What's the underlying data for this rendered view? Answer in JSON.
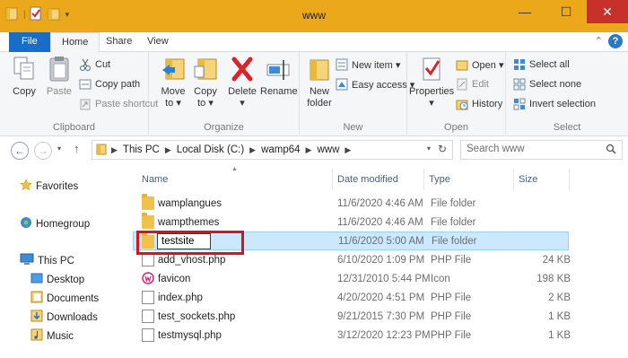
{
  "window": {
    "title": "www"
  },
  "tabs": {
    "file": "File",
    "home": "Home",
    "share": "Share",
    "view": "View"
  },
  "ribbon": {
    "clipboard": {
      "label": "Clipboard",
      "copy": "Copy",
      "paste": "Paste",
      "cut": "Cut",
      "copy_path": "Copy path",
      "paste_shortcut": "Paste shortcut"
    },
    "organize": {
      "label": "Organize",
      "move_to_1": "Move",
      "move_to_2": "to ▾",
      "copy_to_1": "Copy",
      "copy_to_2": "to ▾",
      "delete": "Delete",
      "delete_arrow": "▾",
      "rename": "Rename"
    },
    "new": {
      "label": "New",
      "new_folder_1": "New",
      "new_folder_2": "folder",
      "new_item": "New item ▾",
      "easy_access": "Easy access ▾"
    },
    "open": {
      "label": "Open",
      "properties": "Properties",
      "properties_arrow": "▾",
      "open": "Open ▾",
      "edit": "Edit",
      "history": "History"
    },
    "select": {
      "label": "Select",
      "select_all": "Select all",
      "select_none": "Select none",
      "invert_selection": "Invert selection"
    }
  },
  "address": {
    "crumbs": [
      "This PC",
      "Local Disk (C:)",
      "wamp64",
      "www"
    ],
    "search_placeholder": "Search www"
  },
  "nav": {
    "favorites": "Favorites",
    "homegroup": "Homegroup",
    "this_pc": "This PC",
    "desktop": "Desktop",
    "documents": "Documents",
    "downloads": "Downloads",
    "music": "Music"
  },
  "columns": {
    "name": "Name",
    "date": "Date modified",
    "type": "Type",
    "size": "Size"
  },
  "files": [
    {
      "name": "wamplangues",
      "date": "11/6/2020 4:46 AM",
      "type": "File folder",
      "size": "",
      "icon": "folder-icon"
    },
    {
      "name": "wampthemes",
      "date": "11/6/2020 4:46 AM",
      "type": "File folder",
      "size": "",
      "icon": "folder-icon"
    },
    {
      "name": "testsite",
      "date": "11/6/2020 5:00 AM",
      "type": "File folder",
      "size": "",
      "icon": "folder-icon"
    },
    {
      "name": "add_vhost.php",
      "date": "6/10/2020 1:09 PM",
      "type": "PHP File",
      "size": "24 KB",
      "icon": "php-file-icon"
    },
    {
      "name": "favicon",
      "date": "12/31/2010 5:44 PM",
      "type": "Icon",
      "size": "198 KB",
      "icon": "wamp-icon"
    },
    {
      "name": "index.php",
      "date": "4/20/2020 4:51 PM",
      "type": "PHP File",
      "size": "2 KB",
      "icon": "php-file-icon"
    },
    {
      "name": "test_sockets.php",
      "date": "9/21/2015 7:30 PM",
      "type": "PHP File",
      "size": "1 KB",
      "icon": "php-file-icon"
    },
    {
      "name": "testmysql.php",
      "date": "3/12/2020 12:23 PM",
      "type": "PHP File",
      "size": "1 KB",
      "icon": "php-file-icon"
    }
  ],
  "colors": {
    "file_tab": "#1a6dc7",
    "title_bar": "#eaa81a",
    "selection": "#cce8ff",
    "highlight_box": "#d0161e"
  }
}
